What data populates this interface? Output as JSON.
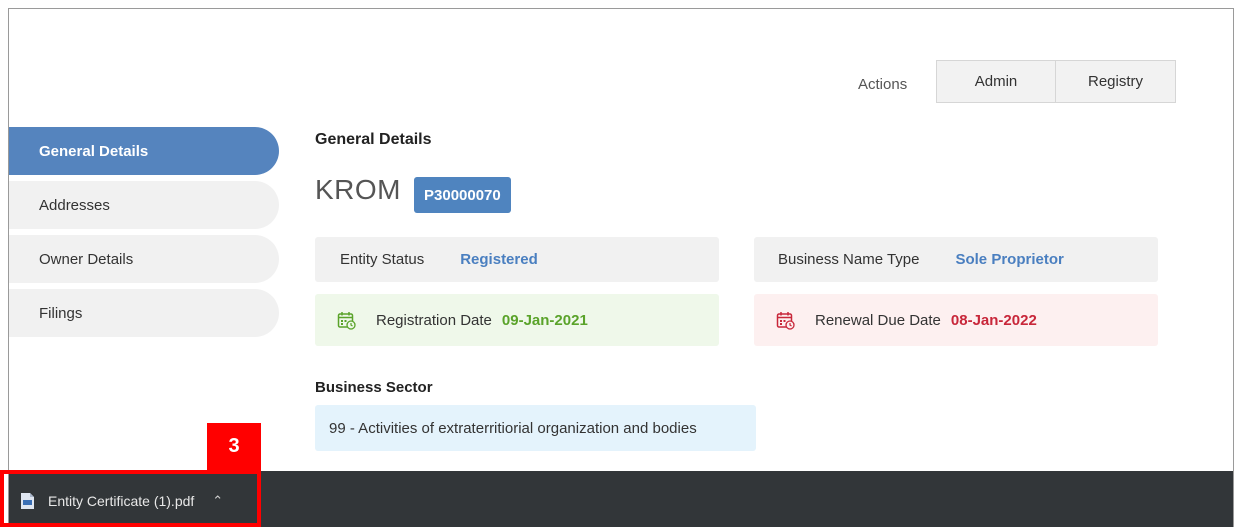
{
  "actions": {
    "label": "Actions",
    "admin_label": "Admin",
    "registry_label": "Registry"
  },
  "sidebar": {
    "items": [
      {
        "label": "General Details",
        "active": true
      },
      {
        "label": "Addresses",
        "active": false
      },
      {
        "label": "Owner Details",
        "active": false
      },
      {
        "label": "Filings",
        "active": false
      }
    ]
  },
  "main": {
    "section_title": "General Details",
    "entity_name": "KROM",
    "entity_number": "P30000070",
    "entity_status": {
      "label": "Entity Status",
      "value": "Registered"
    },
    "business_name_type": {
      "label": "Business Name Type",
      "value": "Sole Proprietor"
    },
    "registration_date": {
      "label": "Registration Date",
      "value": "09-Jan-2021"
    },
    "renewal_due_date": {
      "label": "Renewal Due Date",
      "value": "08-Jan-2022"
    },
    "business_sector": {
      "title": "Business Sector",
      "value": "99 - Activities of extraterritiorial organization and bodies"
    }
  },
  "download_bar": {
    "file_name": "Entity Certificate (1).pdf",
    "file_icon": "pdf-file-icon",
    "chevron_icon": "chevron-up-icon"
  },
  "annotation": {
    "step_number": "3",
    "color": "#ff0000"
  },
  "colors": {
    "accent": "#5584be",
    "green": "#5aa32a",
    "red": "#c8273a",
    "download_bar": "#323639"
  }
}
